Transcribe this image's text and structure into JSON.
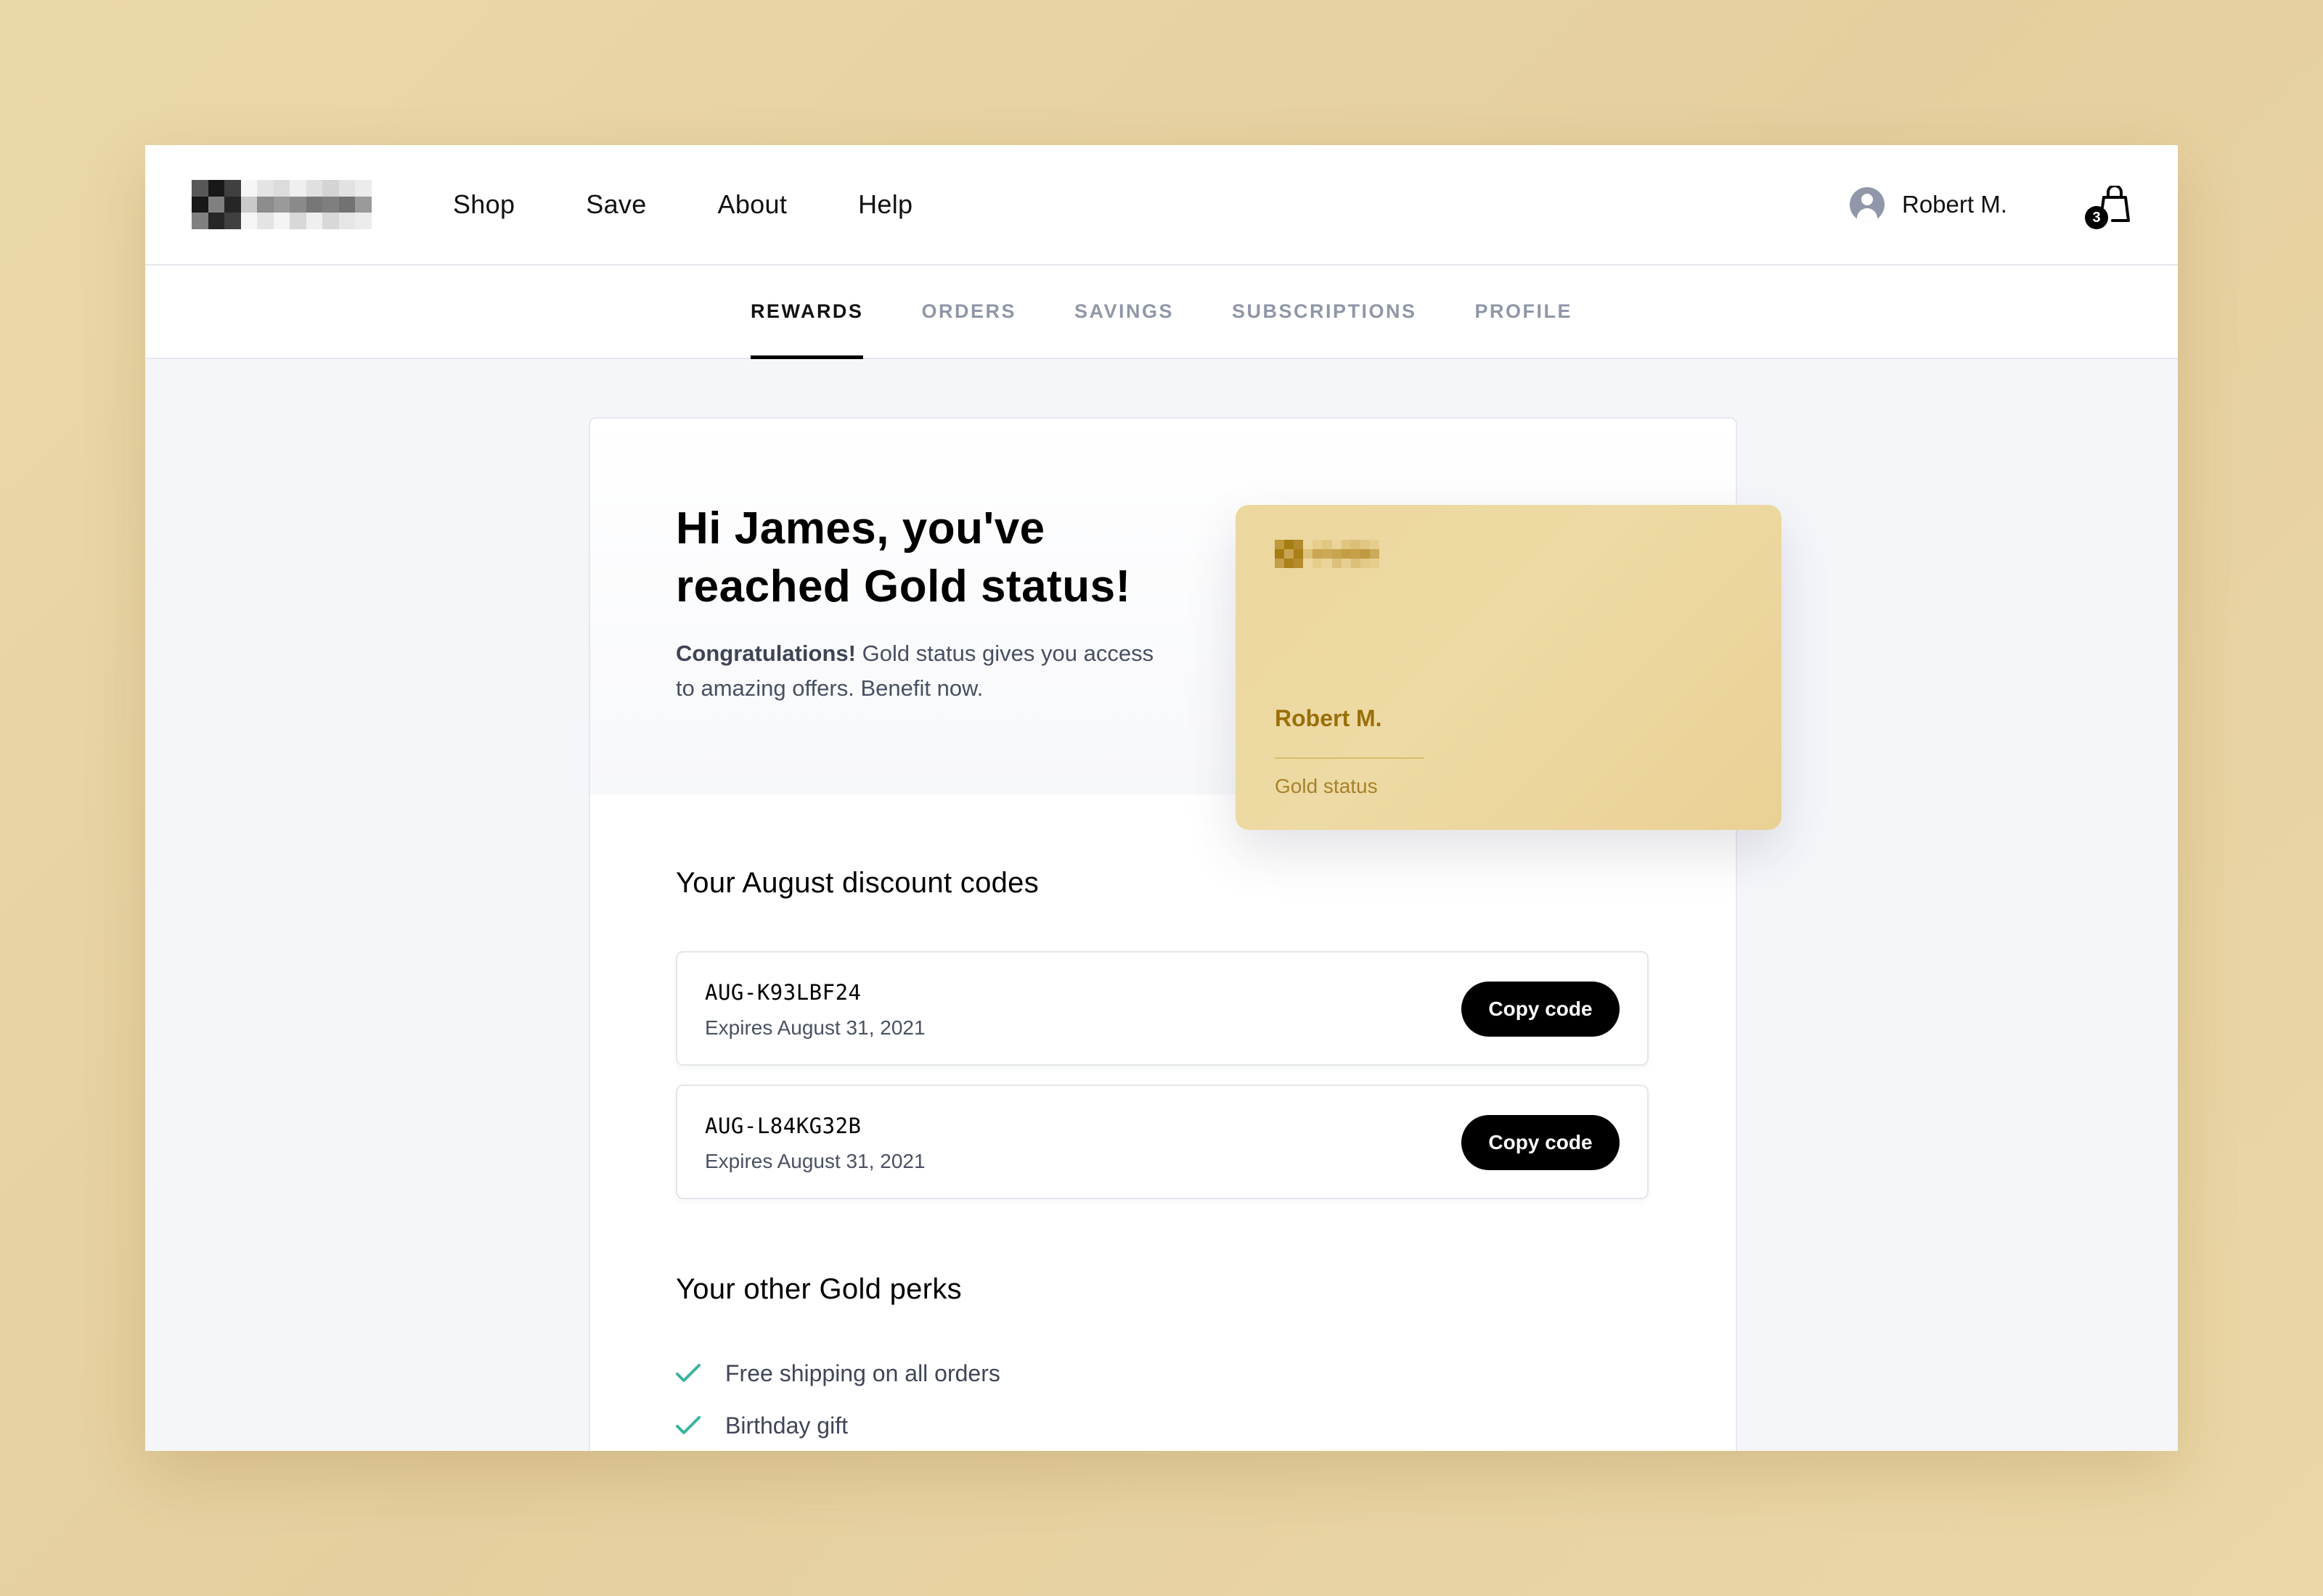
{
  "header": {
    "nav": [
      "Shop",
      "Save",
      "About",
      "Help"
    ],
    "user_name": "Robert M.",
    "cart_count": "3"
  },
  "tabs": [
    {
      "label": "REWARDS",
      "active": true
    },
    {
      "label": "ORDERS",
      "active": false
    },
    {
      "label": "SAVINGS",
      "active": false
    },
    {
      "label": "SUBSCRIPTIONS",
      "active": false
    },
    {
      "label": "PROFILE",
      "active": false
    }
  ],
  "hero": {
    "title": "Hi James, you've reached Gold status!",
    "intro_bold": "Congratulations!",
    "intro_text": " Gold status gives you access to amazing offers. Benefit now."
  },
  "gold_card": {
    "name": "Robert M.",
    "status": "Gold status"
  },
  "discounts": {
    "title": "Your August discount codes",
    "codes": [
      {
        "code": "AUG-K93LBF24",
        "expiry": "Expires August 31, 2021",
        "button": "Copy code"
      },
      {
        "code": "AUG-L84KG32B",
        "expiry": "Expires August 31, 2021",
        "button": "Copy code"
      }
    ]
  },
  "perks": {
    "title": "Your other Gold perks",
    "items": [
      "Free shipping on all orders",
      "Birthday gift"
    ]
  },
  "colors": {
    "accent_check": "#3bb3a0",
    "gold_text": "#9a6f0a",
    "tab_inactive": "#8f97a8"
  }
}
